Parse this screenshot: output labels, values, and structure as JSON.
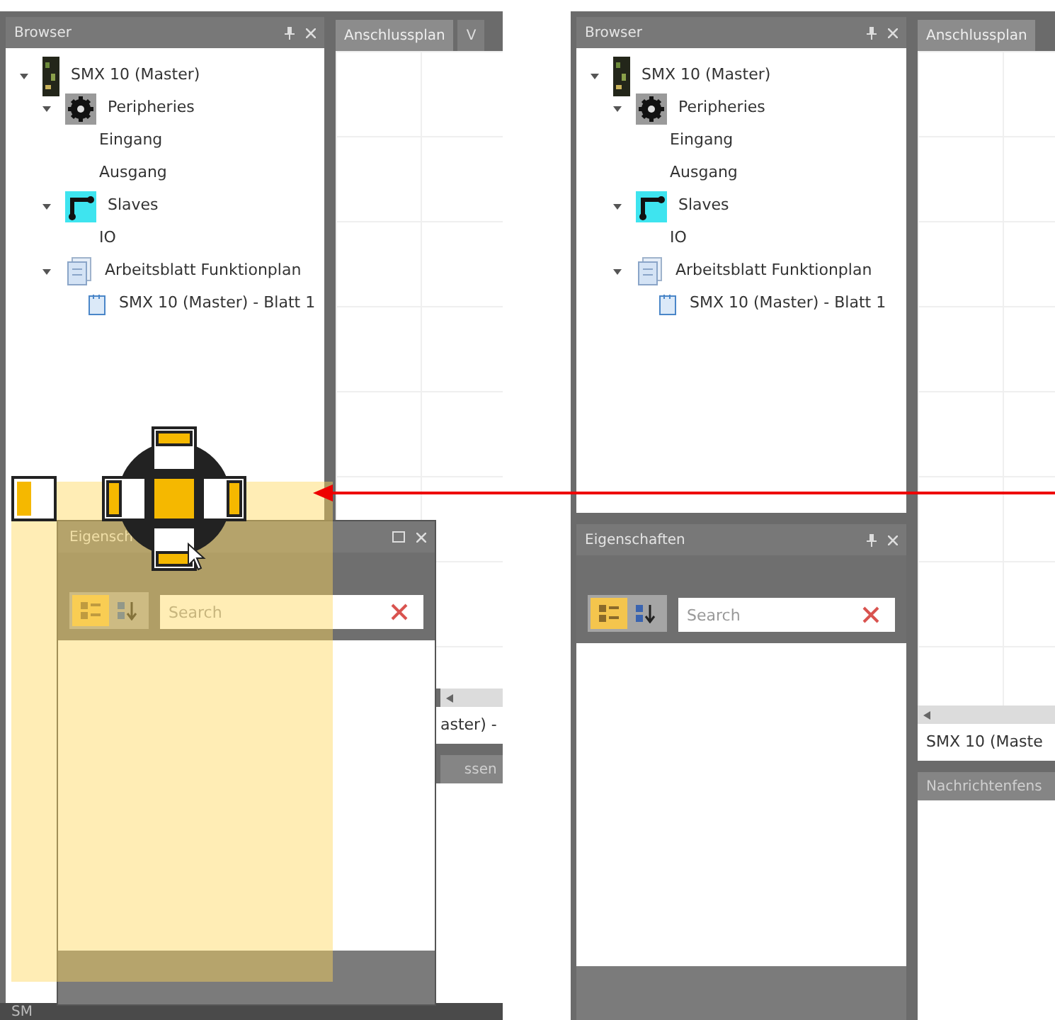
{
  "screenshots": [
    {
      "kind": "dragging",
      "browser": {
        "title": "Browser",
        "tree": [
          {
            "label": "SMX 10 (Master)",
            "kind": "controller",
            "expanded": true,
            "children": [
              {
                "label": "Peripheries",
                "kind": "peripheries",
                "expanded": true,
                "children": [
                  {
                    "label": "Eingang",
                    "kind": "plain"
                  },
                  {
                    "label": "Ausgang",
                    "kind": "plain"
                  }
                ]
              },
              {
                "label": "Slaves",
                "kind": "slaves",
                "expanded": true,
                "children": [
                  {
                    "label": "IO",
                    "kind": "plain"
                  }
                ]
              },
              {
                "label": "Arbeitsblatt Funktionplan",
                "kind": "worksheet",
                "expanded": true,
                "children": [
                  {
                    "label": "SMX 10 (Master) - Blatt 1",
                    "kind": "sheet"
                  }
                ]
              }
            ]
          }
        ]
      },
      "document_tabs": [
        {
          "label": "Anschlussplan",
          "selected": true
        },
        {
          "label": "V",
          "selected": false
        }
      ],
      "document_footer": "aster) -",
      "messages_title": "ssen",
      "properties": {
        "title": "Eigensch",
        "sort_buttons": [
          {
            "kind": "category",
            "selected": true
          },
          {
            "kind": "alphabetical",
            "selected": false
          }
        ],
        "search": {
          "placeholder": "Search"
        }
      },
      "status_text": "SM"
    },
    {
      "kind": "docked",
      "browser": {
        "title": "Browser",
        "tree": [
          {
            "label": "SMX 10 (Master)",
            "kind": "controller",
            "expanded": true,
            "children": [
              {
                "label": "Peripheries",
                "kind": "peripheries",
                "expanded": true,
                "children": [
                  {
                    "label": "Eingang",
                    "kind": "plain"
                  },
                  {
                    "label": "Ausgang",
                    "kind": "plain"
                  }
                ]
              },
              {
                "label": "Slaves",
                "kind": "slaves",
                "expanded": true,
                "children": [
                  {
                    "label": "IO",
                    "kind": "plain"
                  }
                ]
              },
              {
                "label": "Arbeitsblatt Funktionplan",
                "kind": "worksheet",
                "expanded": true,
                "children": [
                  {
                    "label": "SMX 10 (Master) - Blatt 1",
                    "kind": "sheet"
                  }
                ]
              }
            ]
          }
        ]
      },
      "document_tabs": [
        {
          "label": "Anschlussplan",
          "selected": true
        }
      ],
      "document_footer": "SMX 10 (Maste",
      "messages_title": "Nachrichtenfens",
      "properties": {
        "title": "Eigenschaften",
        "sort_buttons": [
          {
            "kind": "category",
            "selected": true
          },
          {
            "kind": "alphabetical",
            "selected": false
          }
        ],
        "search": {
          "placeholder": "Search"
        }
      }
    }
  ]
}
